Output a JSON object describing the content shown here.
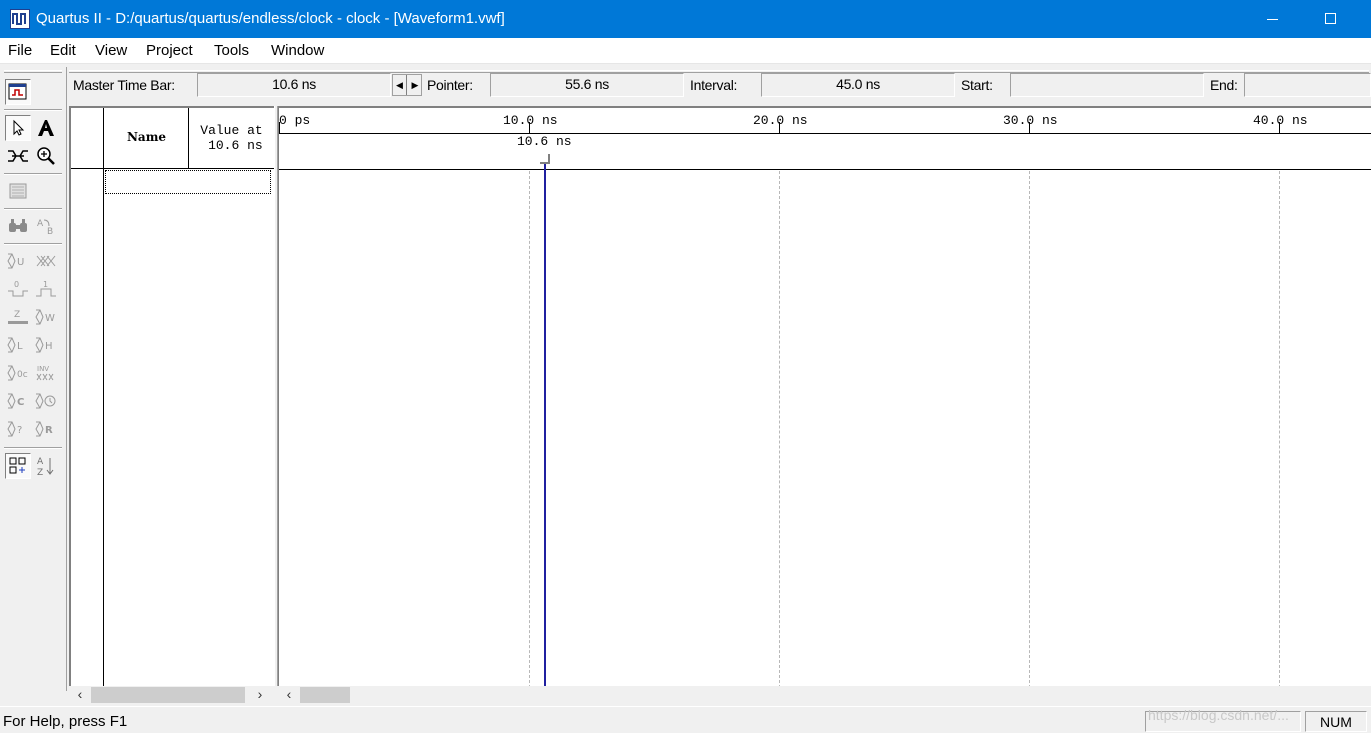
{
  "window": {
    "title": "Quartus II - D:/quartus/quartus/endless/clock - clock - [Waveform1.vwf]"
  },
  "menu": {
    "items": [
      "File",
      "Edit",
      "View",
      "Project",
      "Tools",
      "Window"
    ]
  },
  "timebar": {
    "master_time_bar_label": "Master Time Bar:",
    "master_time_bar_value": "10.6 ns",
    "pointer_label": "Pointer:",
    "pointer_value": "55.6 ns",
    "interval_label": "Interval:",
    "interval_value": "45.0 ns",
    "start_label": "Start:",
    "start_value": "",
    "end_label": "End:",
    "end_value": ""
  },
  "name_panel": {
    "name_header": "Name",
    "value_header": "Value at\n 10.6 ns"
  },
  "ruler": {
    "ticks": [
      "0 ps",
      "10.0 ns",
      "20.0 ns",
      "30.0 ns",
      "40.0 ns"
    ],
    "master_time_bar_marker": "10.6 ns"
  },
  "left_toolbar": {
    "tools": [
      "waveform-editor-icon",
      "selection-tool-icon",
      "text-tool-icon",
      "waveform-editing-tool-icon",
      "zoom-tool-icon",
      "full-screen-icon",
      "find-icon",
      "replace-icon",
      "uninitialized-icon",
      "dont-care-icon",
      "forcing-low-icon",
      "forcing-high-icon",
      "high-impedance-icon",
      "weak-unknown-icon",
      "weak-low-icon",
      "weak-high-icon",
      "invert-icon",
      "count-value-icon",
      "overwrite-clock-icon",
      "arbitrary-value-icon",
      "random-values-icon",
      "snap-to-grid-icon",
      "sort-icon"
    ]
  },
  "statusbar": {
    "help_text": "For Help, press F1",
    "num_indicator": "NUM",
    "watermark": "https://blog.csdn.net/..."
  },
  "colors": {
    "title_bar": "#0078d7",
    "master_time_bar_line": "#2020a0",
    "gridline": "#b8b8b8"
  }
}
